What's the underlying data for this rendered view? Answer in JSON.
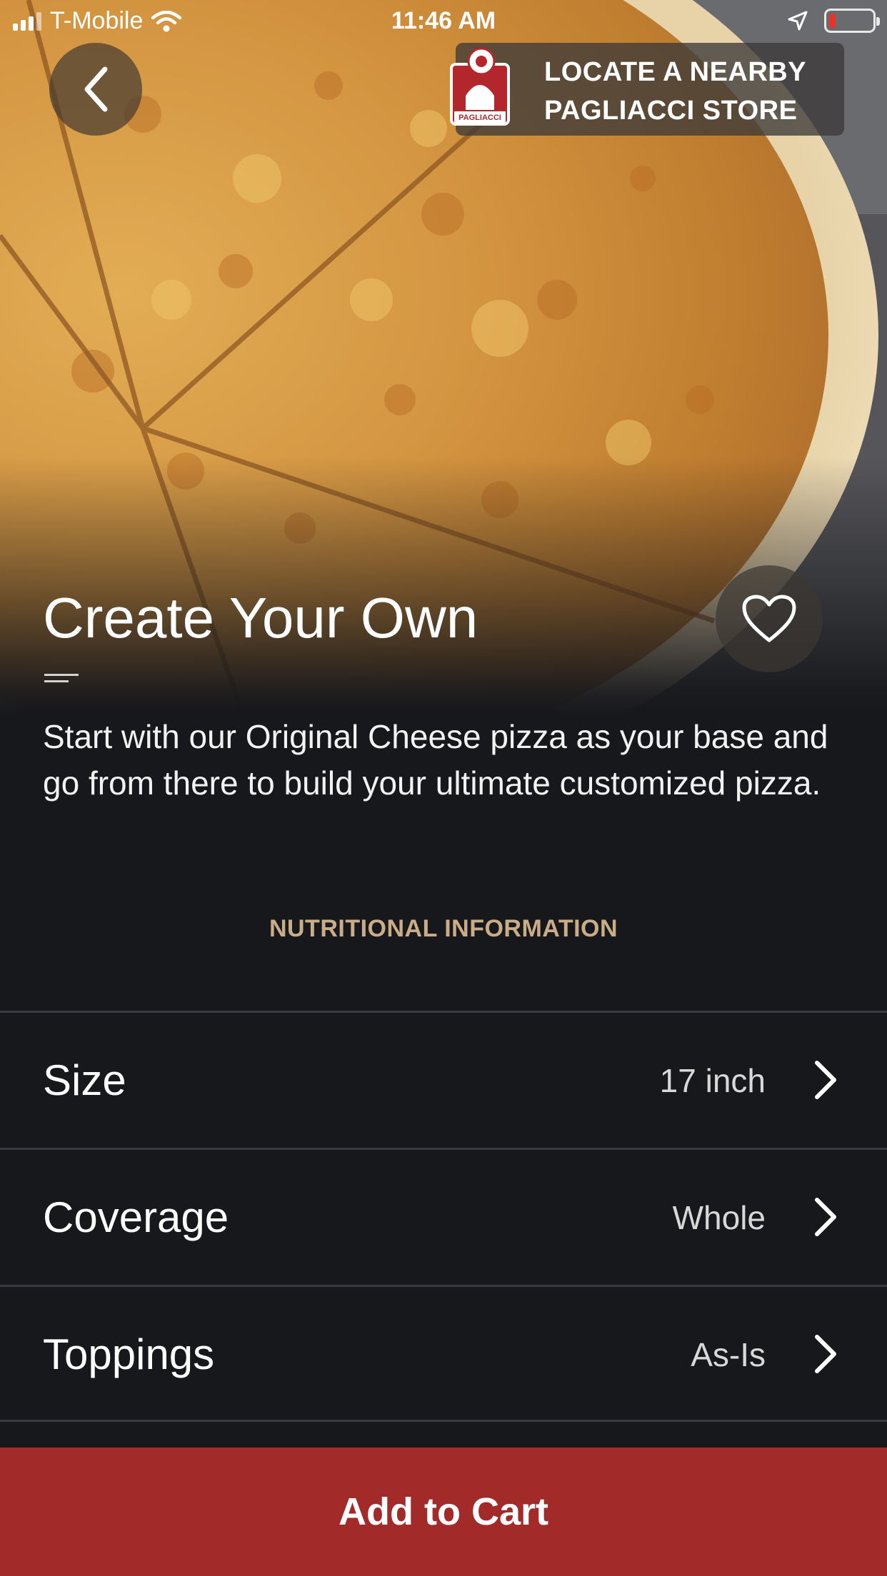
{
  "status_bar": {
    "carrier": "T-Mobile",
    "time": "11:46 AM",
    "battery_level": 0.15,
    "battery_color": "#e8342d"
  },
  "header": {
    "back_icon": "chevron-left-icon",
    "locate_label": "LOCATE A NEARBY\nPAGLIACCI STORE",
    "logo_text": "PAGLIACCI"
  },
  "product": {
    "title": "Create Your Own",
    "description": "Start with our Original Cheese pizza as your base and go from there to build your ultimate customized pizza.",
    "nutrition_link": "NUTRITIONAL INFORMATION",
    "favorite_icon": "heart-outline-icon"
  },
  "options": [
    {
      "label": "Size",
      "value": "17 inch"
    },
    {
      "label": "Coverage",
      "value": "Whole"
    },
    {
      "label": "Toppings",
      "value": "As-Is"
    }
  ],
  "cart": {
    "button_label": "Add to Cart"
  },
  "colors": {
    "background": "#17181c",
    "accent_gold": "#c9ad88",
    "cart_red": "#a22b2a"
  }
}
